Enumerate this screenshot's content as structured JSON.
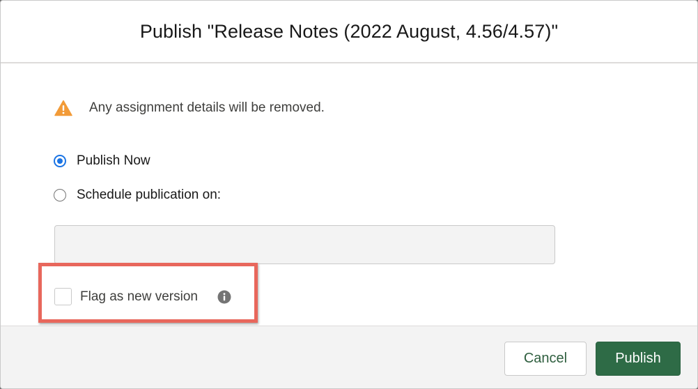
{
  "dialog": {
    "title": "Publish \"Release Notes (2022 August, 4.56/4.57)\""
  },
  "warning": {
    "icon": "warning-icon",
    "text": "Any assignment details will be removed.",
    "color": "#f29b38"
  },
  "publish_options": {
    "selected": "publish_now",
    "now_label": "Publish Now",
    "schedule_label": "Schedule publication on:"
  },
  "schedule_input": {
    "value": "",
    "placeholder": ""
  },
  "flag": {
    "label": "Flag as new version",
    "checked": false,
    "info_icon": "info-icon"
  },
  "footer": {
    "cancel_label": "Cancel",
    "publish_label": "Publish"
  },
  "colors": {
    "primary": "#2e6b46",
    "radio_selected": "#1b74e4",
    "highlight": "#e8675c"
  }
}
